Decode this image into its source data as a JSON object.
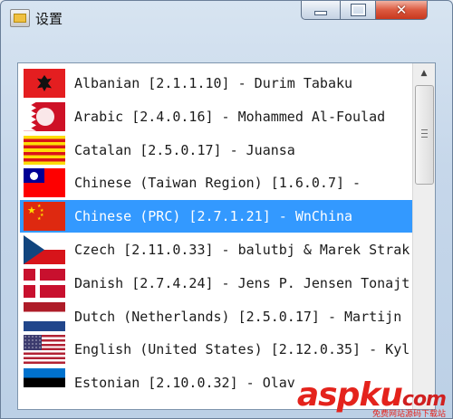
{
  "window": {
    "title": "设置",
    "controls": {
      "minimize": "—",
      "maximize": "□",
      "close": "✕"
    }
  },
  "languages": [
    {
      "flag": "albania",
      "label": "Albanian [2.1.1.10] - Durim Tabaku",
      "selected": false
    },
    {
      "flag": "bahrain",
      "label": "Arabic [2.4.0.16] - Mohammed Al-Foulad",
      "selected": false
    },
    {
      "flag": "catalonia",
      "label": "Catalan [2.5.0.17] - Juansa",
      "selected": false
    },
    {
      "flag": "taiwan",
      "label": "Chinese (Taiwan Region) [1.6.0.7] -",
      "selected": false
    },
    {
      "flag": "china",
      "label": "Chinese (PRC) [2.7.1.21] - WnChina",
      "selected": true
    },
    {
      "flag": "czech",
      "label": "Czech [2.11.0.33] - balutbj & Marek Strak",
      "selected": false
    },
    {
      "flag": "denmark",
      "label": "Danish [2.7.4.24] - Jens P. Jensen Tonajt",
      "selected": false
    },
    {
      "flag": "netherlands",
      "label": "Dutch (Netherlands) [2.5.0.17] - Martijn",
      "selected": false
    },
    {
      "flag": "usa",
      "label": "English (United States) [2.12.0.35] - Kyl",
      "selected": false
    },
    {
      "flag": "estonia",
      "label": "Estonian [2.10.0.32] - Olav",
      "selected": false
    }
  ],
  "watermark": {
    "brand": "aspku",
    "suffix": "com",
    "tagline": "免费网站源码下载站"
  }
}
